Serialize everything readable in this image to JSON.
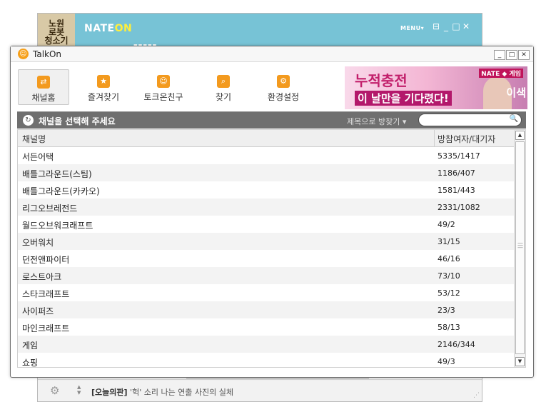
{
  "nateon": {
    "ad_text": "노원\n로봇\n청소기",
    "logo_main": "NATE",
    "logo_on": "ON",
    "menu_label": "MENU▾",
    "footer": {
      "news_tag": "[오늘의판]",
      "news_text": "'헉' 소리 나는 연출 사진의 실체"
    }
  },
  "talkon": {
    "title": "TalkOn",
    "toolbar": [
      {
        "label": "채널홈",
        "icon": "channel-home-icon",
        "active": true
      },
      {
        "label": "즐겨찾기",
        "icon": "star-icon",
        "active": false
      },
      {
        "label": "토크온친구",
        "icon": "smiley-icon",
        "active": false
      },
      {
        "label": "찾기",
        "icon": "magnifier-icon",
        "active": false
      },
      {
        "label": "환경설정",
        "icon": "gear-icon",
        "active": false
      }
    ],
    "banner": {
      "line1": "누적충전",
      "line2": "이 날만을 기다렸다!",
      "brand": "NATE ◆ 게임",
      "character": "이색"
    },
    "channel_bar": {
      "title": "채널을 선택해 주세요",
      "sort_label": "제목으로 방찾기 ▾",
      "search_value": ""
    },
    "table": {
      "columns": [
        "채널명",
        "방참여자/대기자"
      ],
      "rows": [
        {
          "name": "서든어택",
          "count": "5335/1417"
        },
        {
          "name": "배틀그라운드(스팀)",
          "count": "1186/407"
        },
        {
          "name": "배틀그라운드(카카오)",
          "count": "1581/443"
        },
        {
          "name": "리그오브레전드",
          "count": "2331/1082"
        },
        {
          "name": "월드오브워크래프트",
          "count": "49/2"
        },
        {
          "name": "오버워치",
          "count": "31/15"
        },
        {
          "name": "던전앤파이터",
          "count": "46/16"
        },
        {
          "name": "로스트아크",
          "count": "73/10"
        },
        {
          "name": "스타크래프트",
          "count": "53/12"
        },
        {
          "name": "사이퍼즈",
          "count": "23/3"
        },
        {
          "name": "마인크래프트",
          "count": "58/13"
        },
        {
          "name": "게임",
          "count": "2146/344"
        },
        {
          "name": "쇼핑",
          "count": "49/3"
        }
      ]
    }
  },
  "colors": {
    "accent": "#f39a1e",
    "nate_header": "#77c3d6",
    "channel_bar": "#6f6f6f"
  }
}
